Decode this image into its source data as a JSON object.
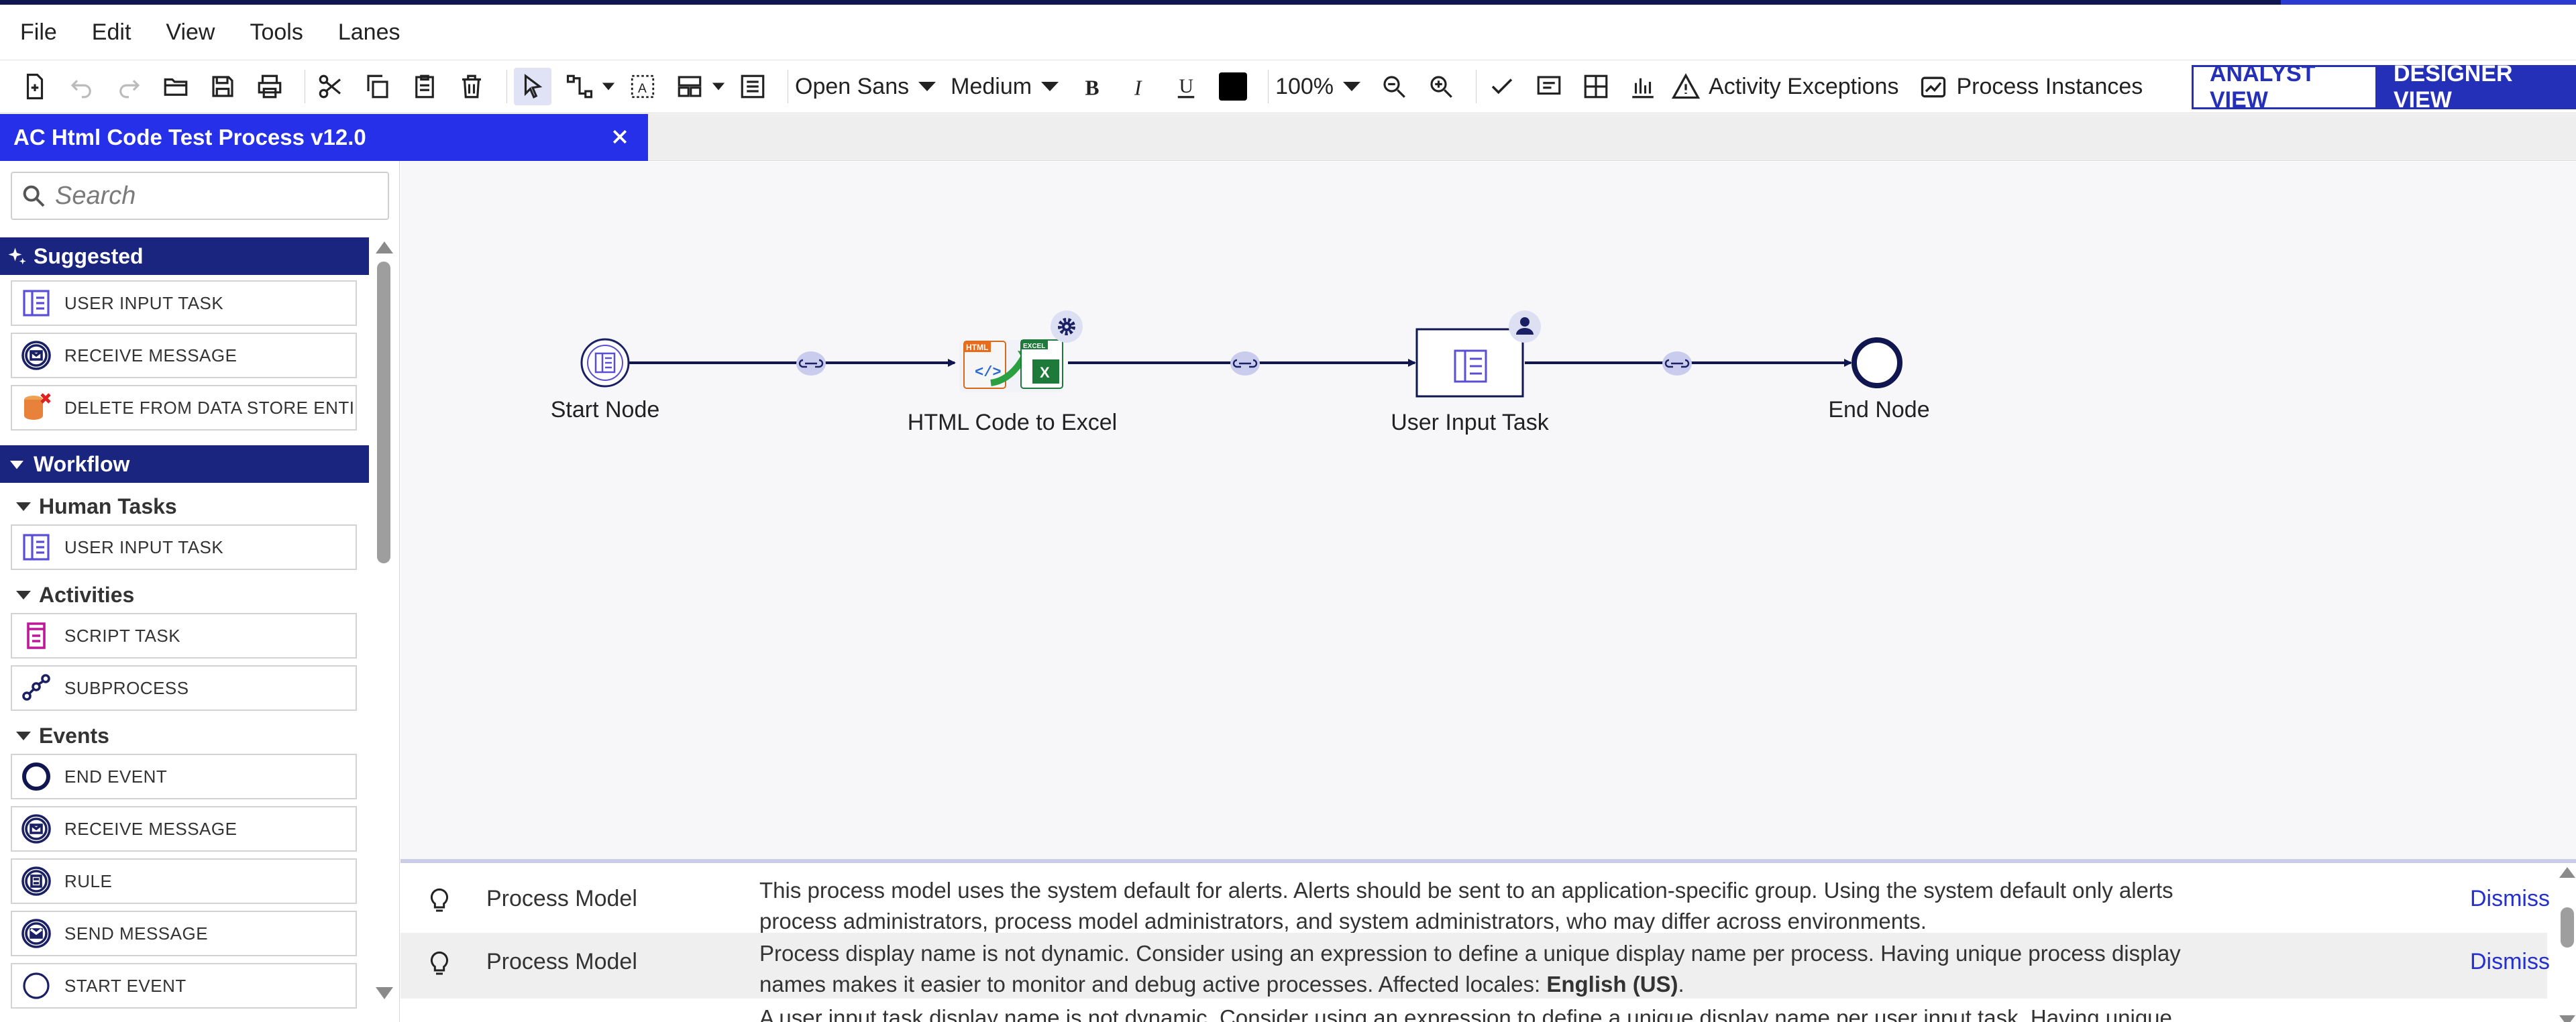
{
  "menu": [
    "File",
    "Edit",
    "View",
    "Tools",
    "Lanes"
  ],
  "toolbar": {
    "font_family": "Open Sans",
    "font_size": "Medium",
    "zoom": "100%",
    "activity_exceptions": "Activity Exceptions",
    "process_instances": "Process Instances",
    "color_swatch": "#000000"
  },
  "views": {
    "analyst": "ANALYST VIEW",
    "designer": "DESIGNER VIEW"
  },
  "tab": {
    "title": "AC Html Code Test Process v12.0"
  },
  "palette": {
    "search_placeholder": "Search",
    "suggested_label": "Suggested",
    "suggested": [
      "USER INPUT TASK",
      "RECEIVE MESSAGE",
      "DELETE FROM DATA STORE ENTI..."
    ],
    "workflow_label": "Workflow",
    "human_tasks_label": "Human Tasks",
    "human_tasks": [
      "USER INPUT TASK"
    ],
    "activities_label": "Activities",
    "activities": [
      "SCRIPT TASK",
      "SUBPROCESS"
    ],
    "events_label": "Events",
    "events": [
      "END EVENT",
      "RECEIVE MESSAGE",
      "RULE",
      "SEND MESSAGE",
      "START EVENT"
    ]
  },
  "flow": {
    "nodes": [
      {
        "label": "Start Node",
        "kind": "start-event"
      },
      {
        "label": "HTML Code to Excel",
        "kind": "smart-service"
      },
      {
        "label": "User Input Task",
        "kind": "user-task"
      },
      {
        "label": "End Node",
        "kind": "end-event"
      }
    ],
    "accent": "#0f1650"
  },
  "messages": [
    {
      "source": "Process Model",
      "text": "This process model uses the system default for alerts. Alerts should be sent to an application-specific group. Using the system default only alerts process administrators, process model administrators, and system administrators, who may differ across environments.",
      "action": "Dismiss"
    },
    {
      "source": "Process Model",
      "text_before": "Process display name is not dynamic. Consider using an expression to define a unique display name per process. Having unique process display names makes it easier to monitor and debug active processes. Affected locales: ",
      "text_bold": "English (US)",
      "text_after": ".",
      "action": "Dismiss"
    },
    {
      "source": "",
      "text": "A user input task display name is not dynamic. Consider using an expression to define a unique display name per user input task. Having unique display names makes",
      "action": ""
    }
  ]
}
